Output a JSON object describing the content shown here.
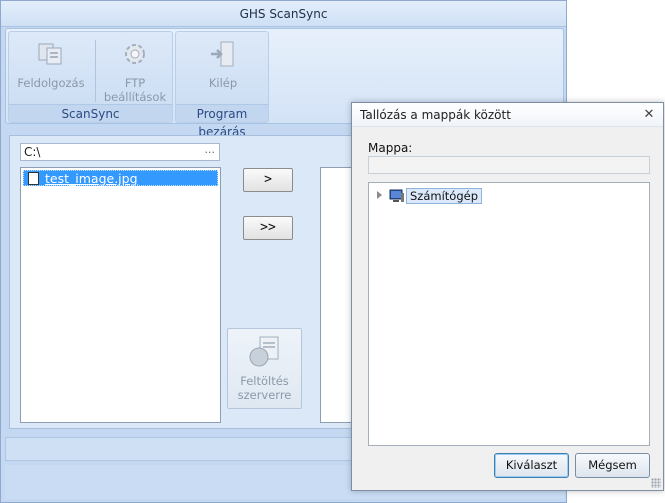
{
  "window": {
    "title": "GHS ScanSync"
  },
  "ribbon": {
    "groups": [
      {
        "caption": "ScanSync",
        "buttons": [
          {
            "label": "Feldolgozás",
            "icon": "process-icon"
          },
          {
            "label": "FTP beállítások",
            "icon": "gear-icon"
          }
        ]
      },
      {
        "caption": "Program bezárás",
        "buttons": [
          {
            "label": "Kilép",
            "icon": "exit-icon"
          }
        ]
      }
    ]
  },
  "main": {
    "path": "C:\\",
    "path_browse": "...",
    "files": [
      {
        "name": "test_image.jpg"
      }
    ],
    "move_one_label": ">",
    "move_all_label": ">>",
    "upload_label": "Feltöltés szerverre"
  },
  "dialog": {
    "title": "Tallózás a mappák között",
    "close_glyph": "✕",
    "folder_label": "Mappa:",
    "folder_value": "",
    "tree": [
      {
        "label": "Számítógép",
        "icon": "computer-icon"
      }
    ],
    "ok_label": "Kiválaszt",
    "cancel_label": "Mégsem"
  },
  "colors": {
    "selection": "#3399ff",
    "window_bg": "#c4d9f1",
    "caption_text": "#2a4b83"
  }
}
